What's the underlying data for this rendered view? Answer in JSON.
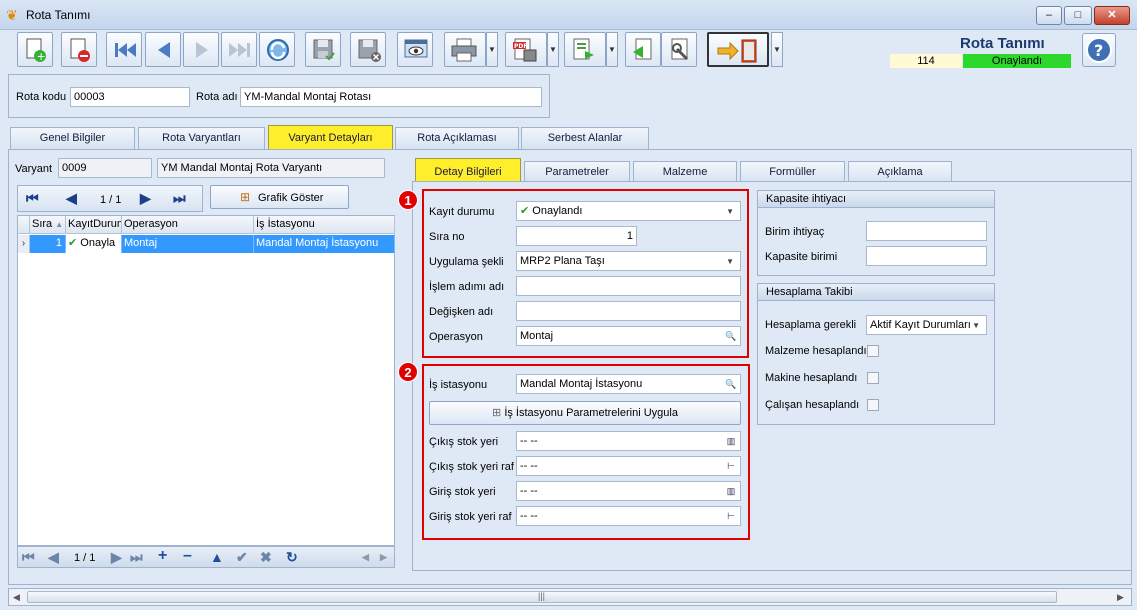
{
  "window": {
    "title": "Rota Tanımı",
    "minimize": "–",
    "maximize": "□",
    "close": "✕"
  },
  "header": {
    "form_title": "Rota Tanımı",
    "record_number": "114",
    "status": "Onaylandı"
  },
  "route": {
    "code_label": "Rota kodu",
    "code_value": "00003",
    "name_label": "Rota adı",
    "name_value": "YM-Mandal Montaj Rotası"
  },
  "tabs": [
    {
      "label": "Genel Bilgiler"
    },
    {
      "label": "Rota Varyantları"
    },
    {
      "label": "Varyant Detayları"
    },
    {
      "label": "Rota Açıklaması"
    },
    {
      "label": "Serbest Alanlar"
    }
  ],
  "variant": {
    "label": "Varyant",
    "code": "0009",
    "name": "YM Mandal Montaj Rota Varyantı"
  },
  "pager": {
    "page": "1 / 1",
    "graph_button": "Grafik Göster"
  },
  "grid": {
    "columns": [
      "Sıra",
      "KayıtDurum",
      "Operasyon",
      "İş İstasyonu"
    ],
    "rows": [
      {
        "sira": "1",
        "durum": "Onayla",
        "operasyon": "Montaj",
        "istasyon": "Mandal Montaj İstasyonu"
      }
    ]
  },
  "bottom_pager": {
    "page": "1 / 1"
  },
  "subtabs": [
    {
      "label": "Detay Bilgileri"
    },
    {
      "label": "Parametreler"
    },
    {
      "label": "Malzeme"
    },
    {
      "label": "Formüller"
    },
    {
      "label": "Açıklama"
    }
  ],
  "badges": [
    "1",
    "2"
  ],
  "detail": {
    "kayit_durumu_label": "Kayıt durumu",
    "kayit_durumu": "Onaylandı",
    "sira_no_label": "Sıra no",
    "sira_no": "1",
    "uygulama_label": "Uygulama şekli",
    "uygulama": "MRP2 Plana Taşı",
    "islem_label": "İşlem adımı adı",
    "islem": "",
    "degisken_label": "Değişken adı",
    "degisken": "",
    "operasyon_label": "Operasyon",
    "operasyon": "Montaj"
  },
  "station": {
    "is_istasyonu_label": "İş istasyonu",
    "is_istasyonu": "Mandal Montaj İstasyonu",
    "apply_button": "İş İstasyonu Parametrelerini Uygula",
    "cikis_label": "Çıkış stok yeri",
    "cikis": "-- --",
    "cikis_raf_label": "Çıkış stok yeri raf",
    "cikis_raf": "-- --",
    "giris_label": "Giriş stok yeri",
    "giris": "-- --",
    "giris_raf_label": "Giriş stok yeri raf",
    "giris_raf": "-- --"
  },
  "capacity": {
    "title": "Kapasite ihtiyacı",
    "birim_label": "Birim ihtiyaç",
    "birim": "",
    "kapasite_label": "Kapasite birimi",
    "kapasite": ""
  },
  "calc": {
    "title": "Hesaplama Takibi",
    "gerekli_label": "Hesaplama gerekli",
    "gerekli": "Aktif Kayıt Durumları",
    "malzeme_label": "Malzeme hesaplandı",
    "makine_label": "Makine hesaplandı",
    "calisan_label": "Çalışan hesaplandı"
  },
  "colors": {
    "accent_tab": "#ffef2a",
    "status_green": "#2bd82b",
    "highlight_red": "#e00000",
    "selection": "#3399ff"
  },
  "icons": [
    "new-record-icon",
    "delete-record-icon",
    "first-icon",
    "prev-icon",
    "next-icon",
    "last-icon",
    "refresh-icon",
    "save-icon",
    "save-close-icon",
    "preview-icon",
    "print-icon",
    "pdf-icon",
    "export-icon",
    "import-icon",
    "tools-icon",
    "exit-icon",
    "help-icon"
  ]
}
